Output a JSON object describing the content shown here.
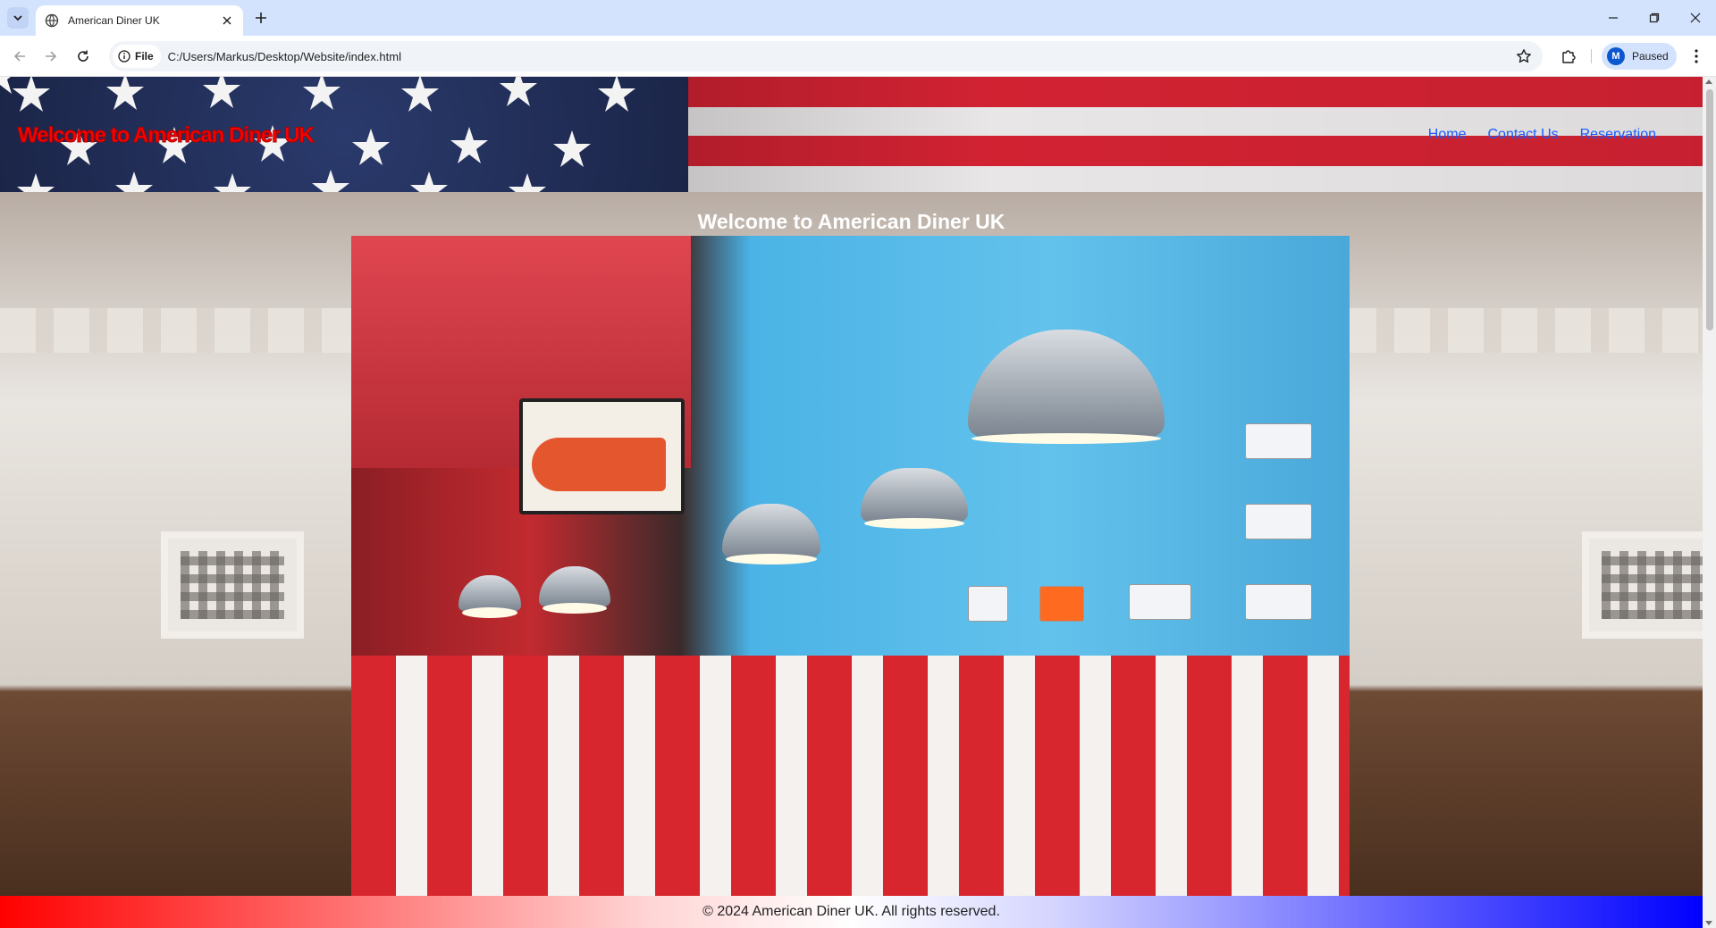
{
  "browser": {
    "tab_title": "American Diner UK",
    "url_scheme_chip": "File",
    "url": "C:/Users/Markus/Desktop/Website/index.html",
    "profile_initial": "M",
    "profile_status": "Paused"
  },
  "site": {
    "header_title": "Welcome to American Diner UK",
    "nav": [
      {
        "label": "Home"
      },
      {
        "label": "Contact Us"
      },
      {
        "label": "Reservation"
      }
    ],
    "hero_title": "Welcome to American Diner UK",
    "carousel": {
      "prev_label": "‹",
      "next_label": "›"
    },
    "footer_text": "© 2024 American Diner UK. All rights reserved."
  },
  "colors": {
    "header_title": "#ff0000",
    "nav_link": "#1a5cff",
    "footer_left": "#ff0000",
    "footer_right": "#0000ff",
    "browser_accent": "#d3e3fd"
  }
}
